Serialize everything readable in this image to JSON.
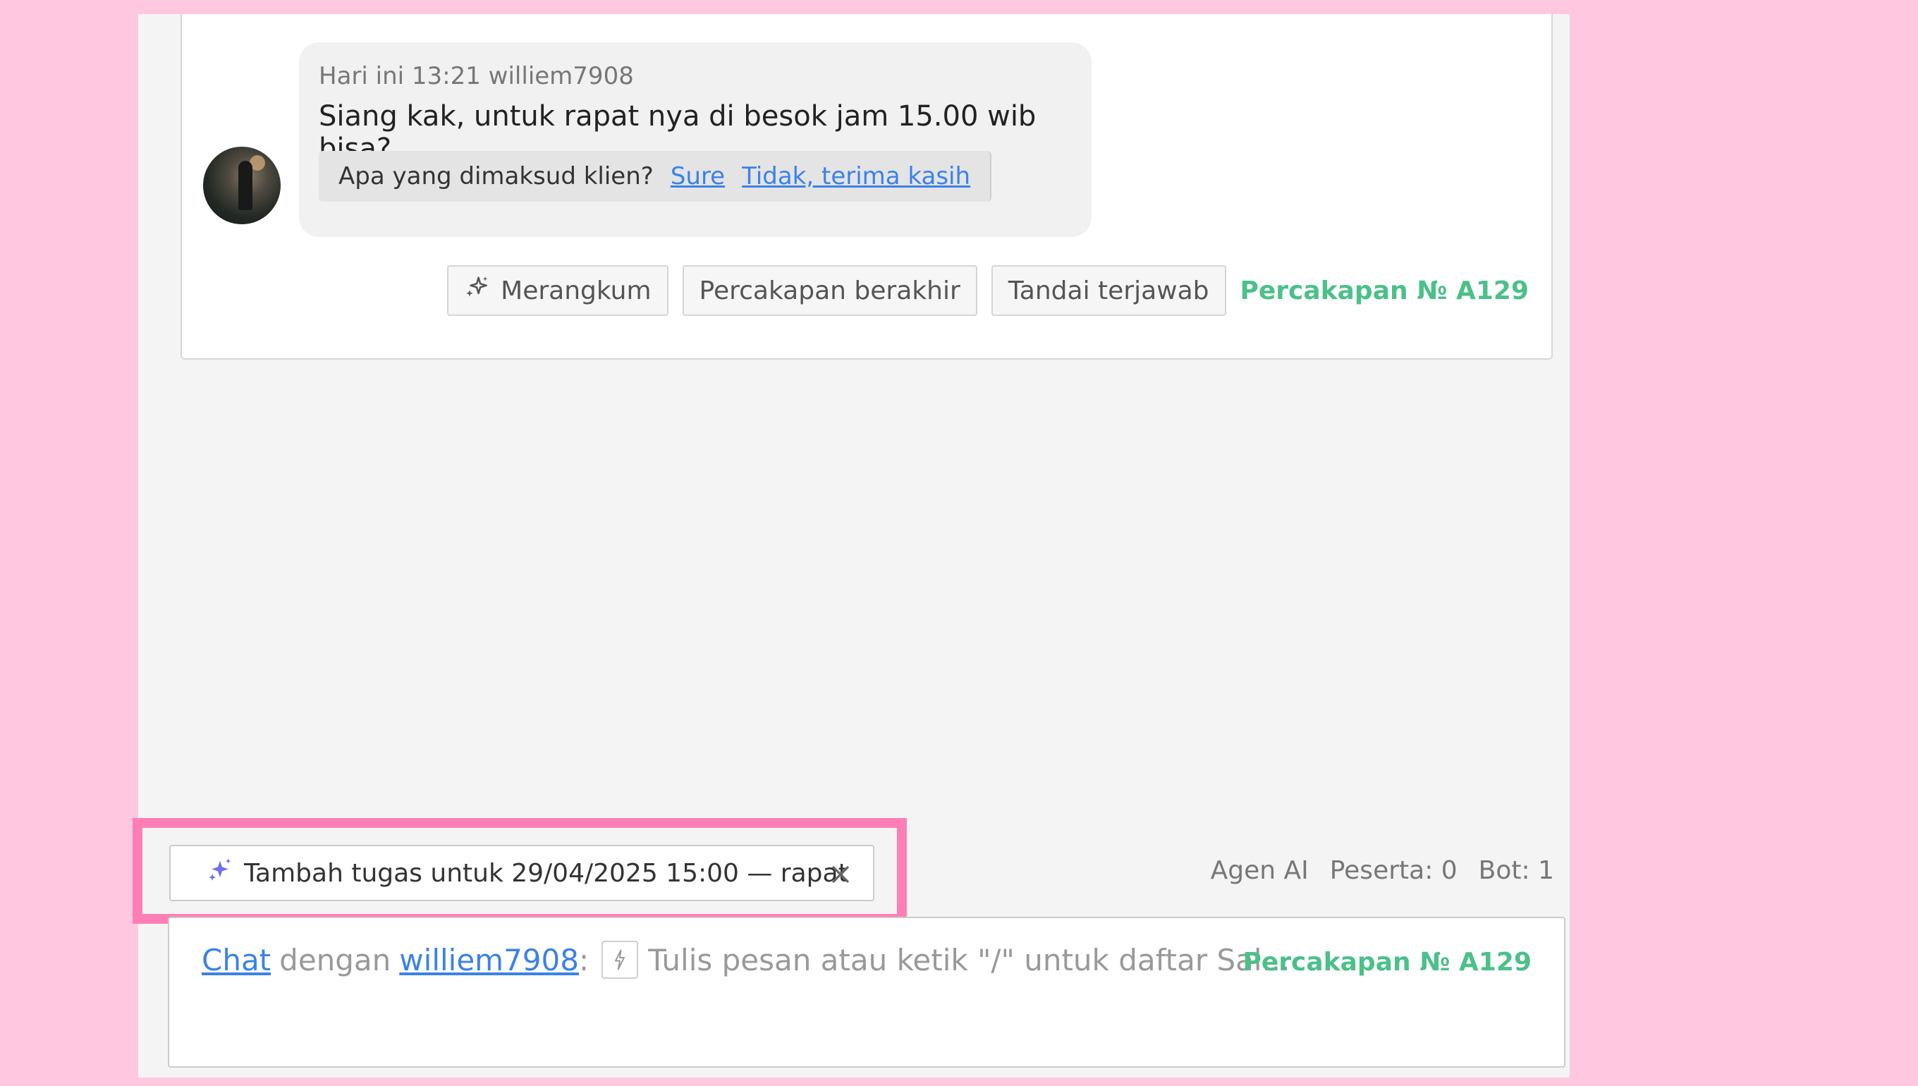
{
  "message": {
    "meta": "Hari ini 13:21 williem7908",
    "text": "Siang kak, untuk rapat nya di besok jam 15.00 wib bisa?",
    "channel_icon": "instagram-icon",
    "suggestion": {
      "question": "Apa yang dimaksud klien?",
      "yes": "Sure",
      "no": "Tidak, terima kasih"
    }
  },
  "actions": {
    "summarize": "Merangkum",
    "end": "Percakapan berakhir",
    "mark_answered": "Tandai terjawab",
    "conversation_number": "Percakapan № A129"
  },
  "ai_suggestion": {
    "text": "Tambah tugas untuk 29/04/2025 15:00 — rapat",
    "icon": "sparkle-icon"
  },
  "stats": {
    "agent": "Agen AI",
    "participants": "Peserta: 0",
    "bots": "Bot: 1"
  },
  "composer": {
    "channel_link": "Chat",
    "connector": "dengan",
    "user_link": "williem7908",
    "colon": ":",
    "placeholder": "Tulis pesan atau ketik \"/\" untuk daftar Sal...",
    "conversation_number": "Percakapan № A129"
  },
  "colors": {
    "accent_link": "#3b82e8",
    "conversation_green": "#4cc08a",
    "highlight_pink": "#ff7eb6",
    "background_pink": "#ffc8e0",
    "sparkle_purple": "#6e6ef0"
  }
}
